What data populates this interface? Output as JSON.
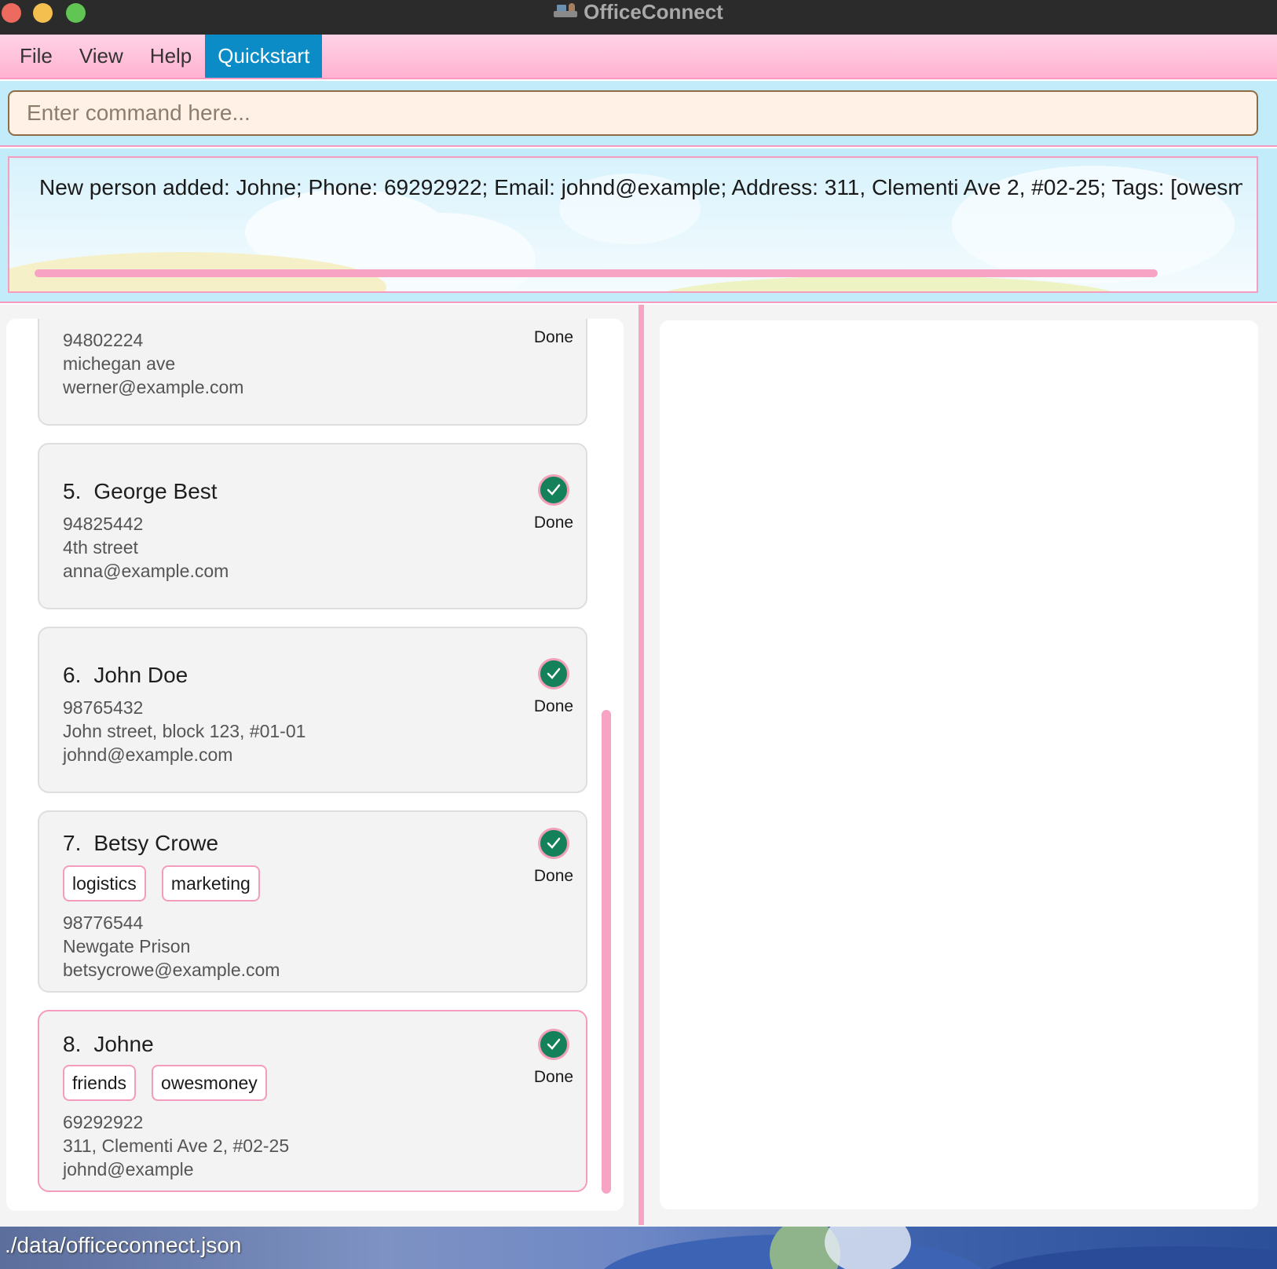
{
  "window": {
    "title": "OfficeConnect"
  },
  "menu": {
    "file": "File",
    "view": "View",
    "help": "Help",
    "quickstart": "Quickstart"
  },
  "command": {
    "placeholder": "Enter command here...",
    "value": ""
  },
  "result": {
    "text": "New person added: Johne; Phone: 69292922; Email: johnd@example; Address: 311, Clementi Ave 2, #02-25; Tags: [owesmoney][friends]"
  },
  "persons": [
    {
      "index": "",
      "name": "",
      "tags": [],
      "phone": "94802224",
      "address": "michegan ave",
      "email": "werner@example.com",
      "status": "Done"
    },
    {
      "index": "5.",
      "name": "George Best",
      "tags": [],
      "phone": "94825442",
      "address": "4th street",
      "email": "anna@example.com",
      "status": "Done"
    },
    {
      "index": "6.",
      "name": "John Doe",
      "tags": [],
      "phone": "98765432",
      "address": "John street, block 123, #01-01",
      "email": "johnd@example.com",
      "status": "Done"
    },
    {
      "index": "7.",
      "name": "Betsy Crowe",
      "tags": [
        "logistics",
        "marketing"
      ],
      "phone": "98776544",
      "address": "Newgate Prison",
      "email": "betsycrowe@example.com",
      "status": "Done"
    },
    {
      "index": "8.",
      "name": "Johne",
      "tags": [
        "friends",
        "owesmoney"
      ],
      "phone": "69292922",
      "address": "311, Clementi Ave 2, #02-25",
      "email": "johnd@example",
      "status": "Done"
    }
  ],
  "statusbar": {
    "path": "./data/officeconnect.json"
  },
  "colors": {
    "accent_pink": "#f7a3c3",
    "menu_active": "#0b8cc7",
    "done_green": "#14815a",
    "command_bg": "#fff1e6"
  }
}
